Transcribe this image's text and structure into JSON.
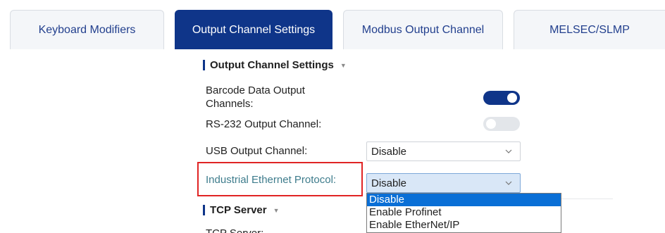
{
  "tabs": [
    {
      "label": "Keyboard Modifiers",
      "active": false
    },
    {
      "label": "Output Channel Settings",
      "active": true
    },
    {
      "label": "Modbus Output Channel",
      "active": false
    },
    {
      "label": "MELSEC/SLMP",
      "active": false
    }
  ],
  "output_section": {
    "title": "Output Channel Settings",
    "barcode_label": "Barcode Data Output Channels:",
    "barcode_toggle": "on",
    "rs232_label": "RS-232 Output Channel:",
    "rs232_toggle": "off",
    "usb_label": "USB Output Channel:",
    "usb_value": "Disable",
    "ethernet_label": "Industrial Ethernet Protocol:",
    "ethernet_value": "Disable",
    "ethernet_options": [
      "Disable",
      "Enable Profinet",
      "Enable EtherNet/IP"
    ],
    "ethernet_selected_option": "Disable"
  },
  "tcp_section": {
    "title": "TCP Server",
    "tcp_label": "TCP Server:"
  },
  "colors": {
    "accent": "#0f3589",
    "highlight_border": "#e02424",
    "dropdown_selected": "#0a6fd6"
  },
  "icons": [
    "caret-down-icon",
    "chevron-down-icon"
  ]
}
